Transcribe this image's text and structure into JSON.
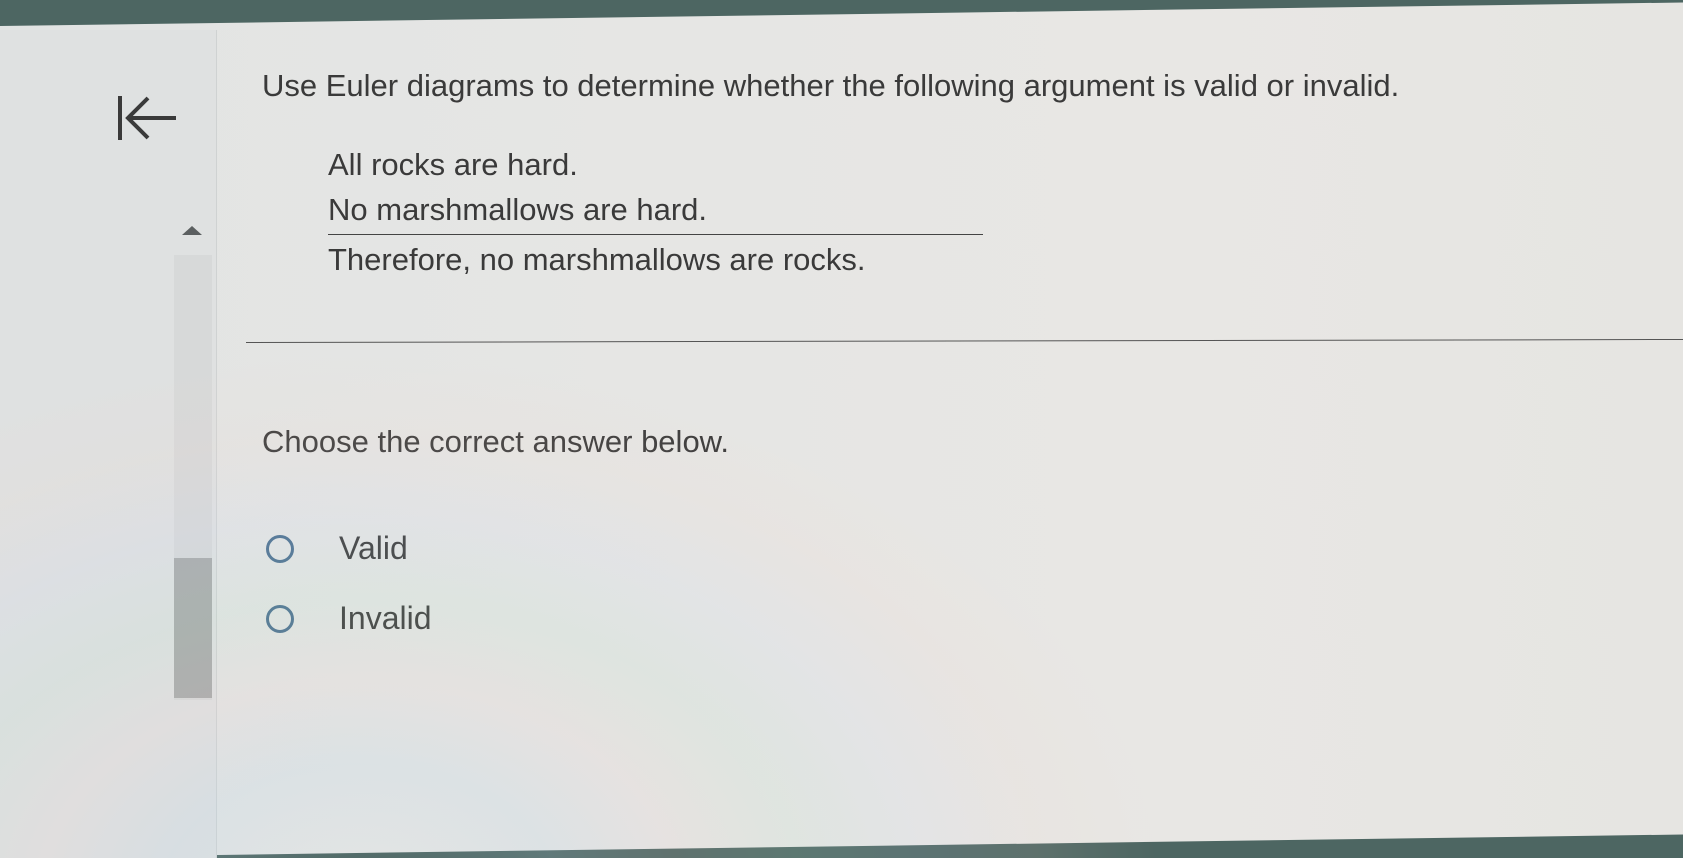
{
  "nav": {
    "back_icon": "first-page-arrow-icon"
  },
  "question": {
    "text": "Use Euler diagrams to determine whether the following argument is valid or invalid.",
    "premise1": "All rocks are hard.",
    "premise2": "No marshmallows are hard.",
    "conclusion": "Therefore, no marshmallows are rocks."
  },
  "answer": {
    "prompt": "Choose the correct answer below.",
    "options": [
      {
        "label": "Valid",
        "selected": false
      },
      {
        "label": "Invalid",
        "selected": false
      }
    ]
  },
  "colors": {
    "bezel": "#4d6662",
    "radio_border": "#4a6f8f",
    "text": "#3a3a3a"
  }
}
